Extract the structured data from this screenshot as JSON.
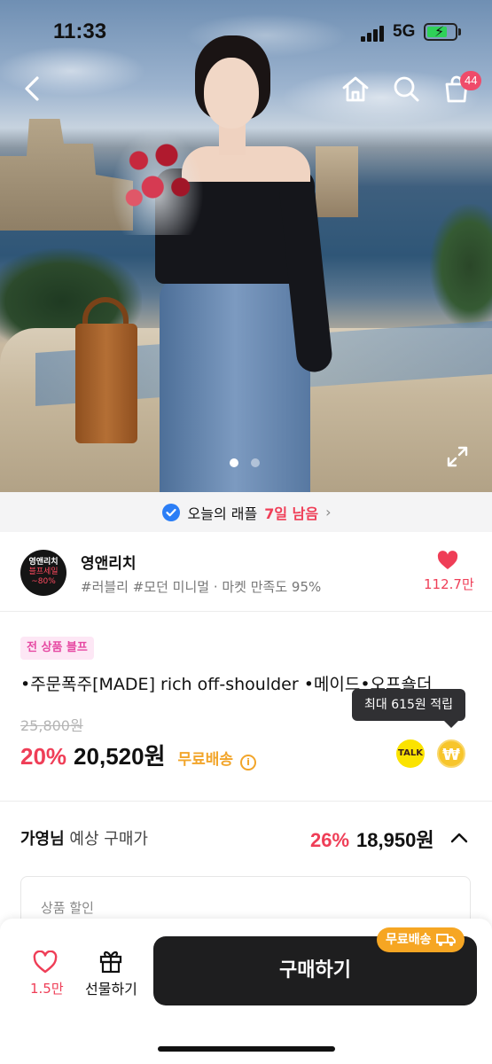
{
  "status_bar": {
    "time": "11:33",
    "network": "5G"
  },
  "header": {
    "cart_count": "44"
  },
  "gallery": {
    "current_index": 1,
    "total": 2
  },
  "raffle": {
    "label": "오늘의 래플",
    "days_left": "7일 남음"
  },
  "store": {
    "logo_line1": "영앤리치",
    "logo_line2": "블프세일",
    "logo_line3": "~80%",
    "name": "영앤리치",
    "tags": "#러블리 #모던 미니멀 · 마켓 만족도 95%",
    "likes": "112.7만"
  },
  "product": {
    "event_badge": "전 상품 블프",
    "title": "•주문폭주[MADE] rich off-shoulder •메이드•오프숄더",
    "original_price": "25,800원",
    "discount": "20%",
    "price": "20,520원",
    "free_shipping": "무료배송",
    "points_tooltip": "최대 615원 적립",
    "talk_label": "TALK",
    "point_symbol": "₩"
  },
  "expected": {
    "user": "가영님",
    "label": "예상 구매가",
    "discount": "26%",
    "price": "18,950원"
  },
  "detail": {
    "label": "상품 할인"
  },
  "bottom_bar": {
    "like_count": "1.5만",
    "gift_label": "선물하기",
    "buy_label": "구매하기",
    "shipping_pill": "무료배송"
  },
  "colors": {
    "accent": "#ef3e57",
    "shipping": "#f2a52a",
    "buy_button": "#1e1e1f"
  }
}
